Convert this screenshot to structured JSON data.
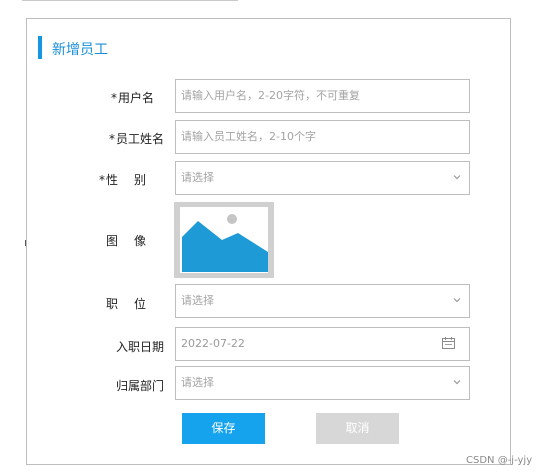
{
  "form": {
    "title": "新增员工",
    "required_mark": "*",
    "fields": {
      "username": {
        "label": "用户名",
        "placeholder": "请输入用户名，2-20字符，不可重复"
      },
      "employee_name": {
        "label": "员工姓名",
        "placeholder": "请输入员工姓名，2-10个字"
      },
      "gender": {
        "label": "性别",
        "placeholder": "请选择"
      },
      "avatar": {
        "label": "图像"
      },
      "position": {
        "label": "职位",
        "placeholder": "请选择"
      },
      "hire_date": {
        "label": "入职日期",
        "value": "2022-07-22"
      },
      "department": {
        "label": "归属部门",
        "placeholder": "请选择"
      }
    },
    "buttons": {
      "save": "保存",
      "cancel": "取消"
    }
  },
  "icons": {
    "chevron": "chevron-down-icon",
    "calendar": "calendar-icon",
    "image_placeholder": "image-placeholder-icon"
  },
  "colors": {
    "accent": "#1596e0",
    "save_button": "#16a3ee",
    "cancel_button": "#d7d7d7"
  },
  "watermark": "CSDN @-j-yjy"
}
